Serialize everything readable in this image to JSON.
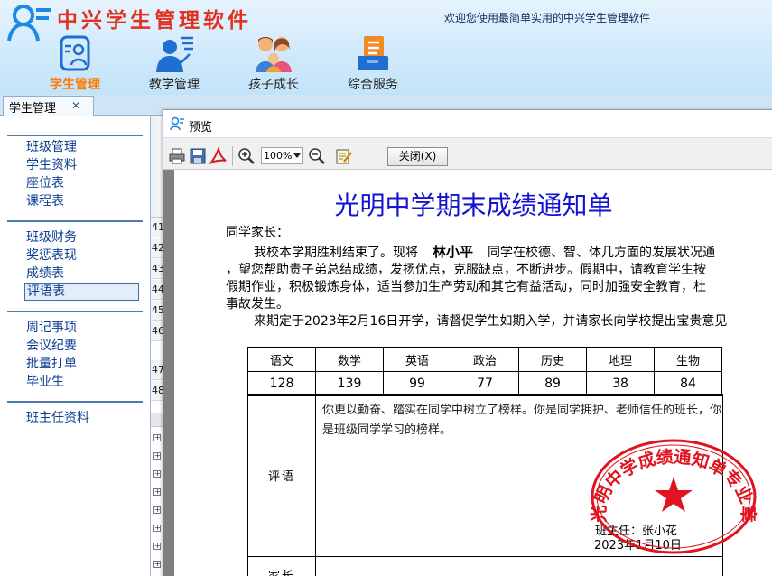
{
  "app": {
    "title": "中兴学生管理软件",
    "welcome": "欢迎您使用最简单实用的中兴学生管理软件"
  },
  "nav": [
    {
      "label": "学生管理",
      "icon": "student-card-icon",
      "active": true
    },
    {
      "label": "教学管理",
      "icon": "teacher-icon",
      "active": false
    },
    {
      "label": "孩子成长",
      "icon": "family-icon",
      "active": false
    },
    {
      "label": "综合服务",
      "icon": "services-icon",
      "active": false
    }
  ],
  "tabs": [
    {
      "label": "学生管理",
      "close": "✕"
    }
  ],
  "sidebar": {
    "groups": [
      {
        "items": [
          "班级管理",
          "学生资料",
          "座位表",
          "课程表"
        ]
      },
      {
        "items": [
          "班级财务",
          "奖惩表现",
          "成绩表",
          "评语表"
        ]
      },
      {
        "items": [
          "周记事项",
          "会议纪要",
          "批量打单",
          "毕业生"
        ]
      },
      {
        "items": [
          "班主任资料"
        ]
      }
    ],
    "selected": "评语表"
  },
  "background_table": {
    "row_numbers": [
      "41",
      "42",
      "43",
      "44",
      "45",
      "46",
      "47",
      "48"
    ]
  },
  "preview": {
    "title": "预览",
    "toolbar": {
      "zoom": "100%",
      "close_label": "关闭(X)"
    },
    "document": {
      "title": "光明中学期末成绩通知单",
      "salutation": "同学家长：",
      "p1_before": "我校本学期胜利结束了。现将",
      "student_name": "林小平",
      "p1_after": "同学在校德、智、体几方面的发展状况通",
      "line2": "，望您帮助贵子弟总结成绩，发扬优点，克服缺点，不断进步。假期中，请教育学生按",
      "line3": "假期作业，积极锻炼身体，适当参加生产劳动和其它有益活动，同时加强安全教育，杜",
      "line4": "事故发生。",
      "line5": "来期定于2023年2月16日开学，请督促学生如期入学，并请家长向学校提出宝贵意见",
      "subjects": [
        "语文",
        "数学",
        "英语",
        "政治",
        "历史",
        "地理",
        "生物"
      ],
      "scores": [
        "128",
        "139",
        "99",
        "77",
        "89",
        "38",
        "84"
      ],
      "comment_label": "评语",
      "comment": "你更以勤奋、踏实在同学中树立了榜样。你是同学拥护、老师信任的班长，你是班级同学学习的榜样。",
      "teacher": "班主任：张小花",
      "date": "2023年1月10日",
      "parent_label": "家长",
      "stamp_text": "光明中学成绩通知单专业章",
      "stamp_color": "#e0141e"
    }
  }
}
